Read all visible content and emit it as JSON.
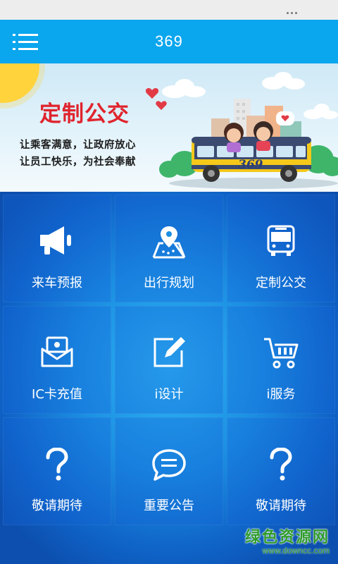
{
  "header": {
    "title": "369"
  },
  "banner": {
    "title": "定制公交",
    "line1": "让乘客满意，让政府放心",
    "line2": "让员工快乐，为社会奉献",
    "bus_number": "369"
  },
  "tiles": [
    {
      "label": "来车预报",
      "icon": "megaphone-icon"
    },
    {
      "label": "出行规划",
      "icon": "map-pin-icon"
    },
    {
      "label": "定制公交",
      "icon": "bus-icon"
    },
    {
      "label": "IC卡充值",
      "icon": "envelope-card-icon"
    },
    {
      "label": "i设计",
      "icon": "edit-icon"
    },
    {
      "label": "i服务",
      "icon": "cart-icon"
    },
    {
      "label": "敬请期待",
      "icon": "question-icon"
    },
    {
      "label": "重要公告",
      "icon": "chat-bubble-icon"
    },
    {
      "label": "敬请期待",
      "icon": "question-icon"
    }
  ],
  "watermark": {
    "name": "绿色资源网",
    "url": "www.downcc.com"
  },
  "colors": {
    "appbar": "#0aa6ee",
    "banner_title": "#e0242d",
    "tile_text": "#ffffff",
    "watermark": "#2f9c2a"
  }
}
